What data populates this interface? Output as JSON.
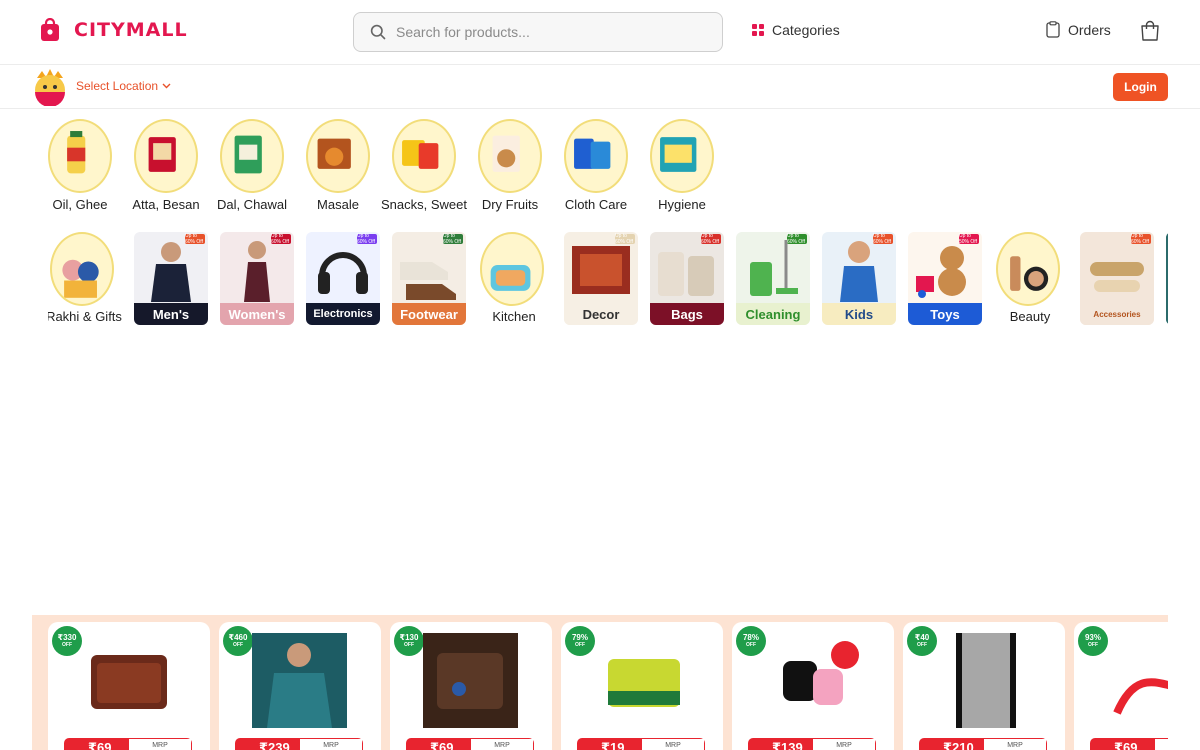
{
  "header": {
    "brand": "CITYMALL",
    "search_placeholder": "Search for products...",
    "categories_label": "Categories",
    "orders_label": "Orders"
  },
  "location_bar": {
    "select_location": "Select Location",
    "login_label": "Login"
  },
  "colors": {
    "brand": "#e3174f",
    "accent": "#ef5324",
    "deal_badge": "#1f9d4a",
    "deal_strip": "#fde3d3"
  },
  "top_categories": [
    {
      "label": "Oil, Ghee",
      "icon": "oil-bottle-icon"
    },
    {
      "label": "Atta, Besan",
      "icon": "flour-bag-icon"
    },
    {
      "label": "Dal, Chawal",
      "icon": "rice-bag-icon"
    },
    {
      "label": "Masale",
      "icon": "spice-pack-icon"
    },
    {
      "label": "Snacks, Sweet",
      "icon": "snack-pack-icon"
    },
    {
      "label": "Dry Fruits",
      "icon": "dry-fruits-icon"
    },
    {
      "label": "Cloth Care",
      "icon": "detergent-icon"
    },
    {
      "label": "Hygiene",
      "icon": "hygiene-pack-icon"
    }
  ],
  "shop_categories": [
    {
      "label": "Rakhi & Gifts",
      "style": "round",
      "icon": "rakhi-gift-icon"
    },
    {
      "label": "Men's",
      "style": "tile",
      "bg": "#f0f0f4",
      "bar": "#15182a",
      "icon": "men-fashion-icon",
      "badge": "Up to 60% Off",
      "badge_color": "#e8522b"
    },
    {
      "label": "Women's",
      "style": "tile",
      "bg": "#f4e9ea",
      "bar": "#e3a4ad",
      "icon": "women-fashion-icon",
      "badge": "Up to 60% Off",
      "badge_color": "#c8102e"
    },
    {
      "label": "Electronics",
      "style": "tile",
      "bg": "#eef2ff",
      "bar": "#12192f",
      "icon": "headphones-icon",
      "badge": "Up to 60% Off",
      "badge_color": "#7a3ef0"
    },
    {
      "label": "Footwear",
      "style": "tile",
      "bg": "#f4ede4",
      "bar": "#e2763a",
      "icon": "shoes-icon",
      "badge": "Up to 60% Off",
      "badge_color": "#2f7d3a"
    },
    {
      "label": "Kitchen",
      "style": "round",
      "icon": "lunchbox-icon"
    },
    {
      "label": "Decor",
      "style": "tile",
      "bg": "#f6efe4",
      "bar": "#f6efe4",
      "bar_text": "#333333",
      "icon": "rug-icon",
      "badge": "Up to 60% Off",
      "badge_color": "#e4d3b0"
    },
    {
      "label": "Bags",
      "style": "tile",
      "bg": "#ece7e2",
      "bar": "#7c1027",
      "icon": "luggage-icon",
      "badge": "Up to 60% Off",
      "badge_color": "#d8302a"
    },
    {
      "label": "Cleaning",
      "style": "tile",
      "bg": "#eef4ea",
      "bar": "#e8f1cf",
      "bar_text": "#2f8f2c",
      "icon": "mop-icon",
      "badge": "Up to 60% Off",
      "badge_color": "#2f8f2c"
    },
    {
      "label": "Kids",
      "style": "tile",
      "bg": "#e9f1f8",
      "bar": "#f7ecc0",
      "bar_text": "#214a8a",
      "icon": "kid-icon",
      "badge": "Up to 60% Off",
      "badge_color": "#e8522b"
    },
    {
      "label": "Toys",
      "style": "tile",
      "bg": "#fdf6ee",
      "bar": "#1d5bd6",
      "icon": "teddy-bear-icon",
      "badge": "Up to 50% Off",
      "badge_color": "#e3174f"
    },
    {
      "label": "Beauty",
      "style": "round",
      "icon": "makeup-icon"
    },
    {
      "label": "Accessories",
      "style": "tile",
      "bg": "#f3e6da",
      "bar": "#f3e6da",
      "bar_text": "#b3541e",
      "icon": "hair-clip-icon",
      "badge": "Up to 60% Off",
      "badge_color": "#e8522b"
    },
    {
      "label": "",
      "style": "tile",
      "bg": "#2b6b6b",
      "bar": "#2b6b6b",
      "icon": "more-icon",
      "badge": "",
      "badge_color": "#2b6b6b"
    }
  ],
  "deals": [
    {
      "off": "₹330",
      "icon": "wallet-icon",
      "price": "₹69",
      "mrp": "MRP"
    },
    {
      "off": "₹460",
      "icon": "sweater-icon",
      "price": "₹239",
      "mrp": "MRP"
    },
    {
      "off": "₹130",
      "icon": "leather-wallet-icon",
      "price": "₹69",
      "mrp": "MRP"
    },
    {
      "off": "79%",
      "icon": "scrub-sponge-icon",
      "price": "₹19",
      "mrp": "MRP"
    },
    {
      "off": "78%",
      "icon": "smartwatch-icon",
      "price": "₹139",
      "mrp": "MRP"
    },
    {
      "off": "₹40",
      "icon": "lace-fabric-icon",
      "price": "₹210",
      "mrp": "MRP"
    },
    {
      "off": "93%",
      "icon": "usb-cable-icon",
      "price": "₹69",
      "mrp": "MRP"
    }
  ],
  "off_suffix": "OFF"
}
